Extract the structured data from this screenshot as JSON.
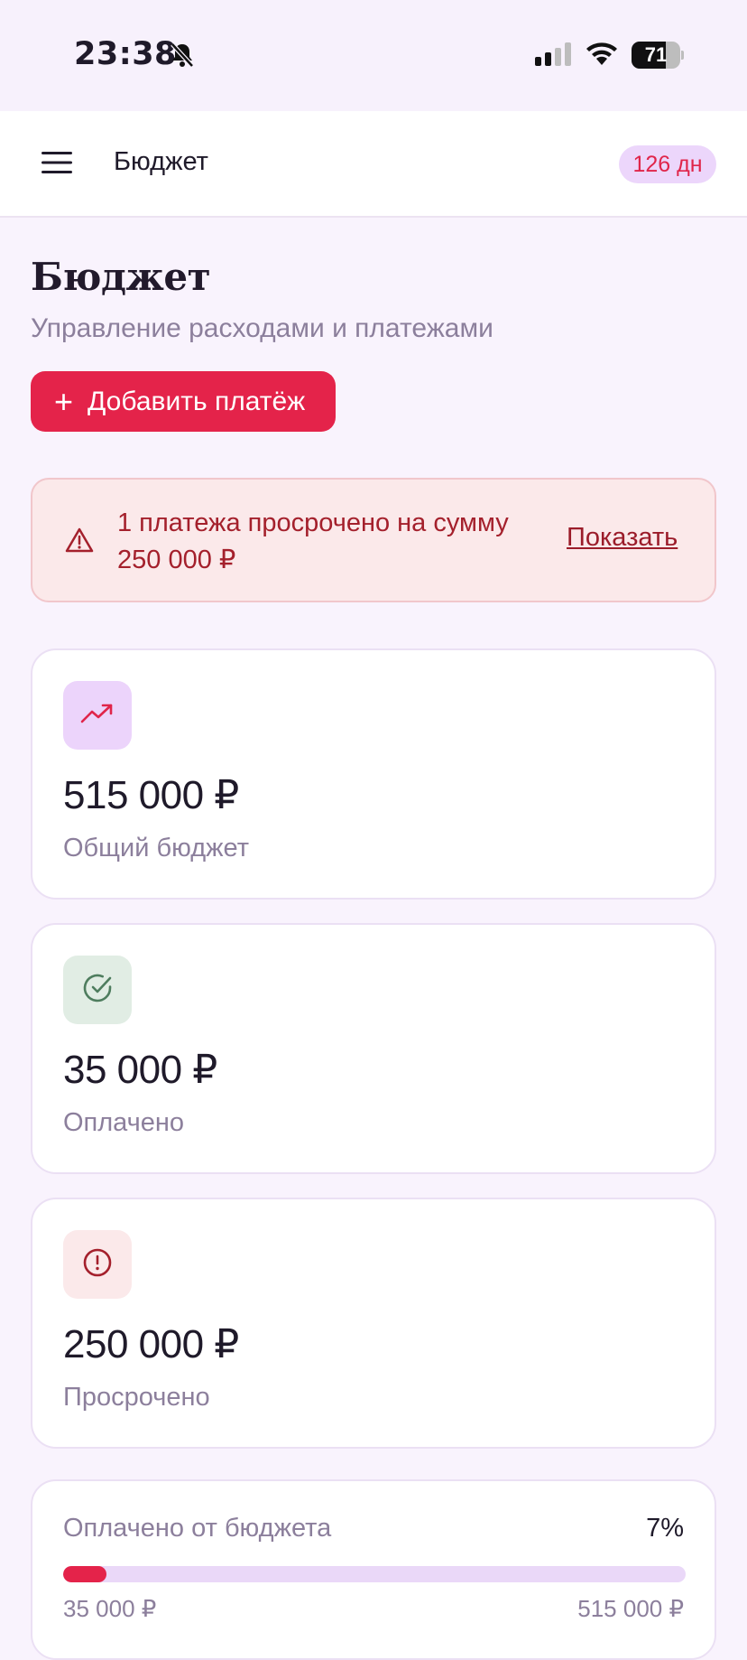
{
  "status_bar": {
    "time": "23:38",
    "battery": "71",
    "battery_level": 0.71,
    "icons": [
      "bell-muted-icon",
      "cellular-signal-icon",
      "wifi-icon",
      "battery-icon"
    ]
  },
  "app_bar": {
    "title": "Бюджет",
    "days_badge": "126 дн",
    "menu_icon": "hamburger-menu-icon"
  },
  "header": {
    "title": "Бюджет",
    "subtitle": "Управление расходами и платежами",
    "add_button": "Добавить платёж"
  },
  "alert": {
    "text": "1 платежа просрочено на сумму 250 000 ₽",
    "link": "Показать",
    "icon": "warning-triangle-icon"
  },
  "stats": [
    {
      "value": "515 000 ₽",
      "label": "Общий бюджет",
      "icon": "trending-up-icon",
      "icon_bg": "#ecd4fb",
      "icon_color": "#e0254a"
    },
    {
      "value": "35 000 ₽",
      "label": "Оплачено",
      "icon": "check-circle-icon",
      "icon_bg": "#e1ede4",
      "icon_color": "#4e7d5e"
    },
    {
      "value": "250 000 ₽",
      "label": "Просрочено",
      "icon": "alert-circle-icon",
      "icon_bg": "#fbe9ea",
      "icon_color": "#a4202c"
    }
  ],
  "progress": {
    "label": "Оплачено от бюджета",
    "percent_text": "7%",
    "percent": 7,
    "min": "35 000 ₽",
    "max": "515 000 ₽"
  },
  "colors": {
    "accent": "#e4234a",
    "background": "#f9f3fd",
    "muted_text": "#8c7f9c"
  }
}
